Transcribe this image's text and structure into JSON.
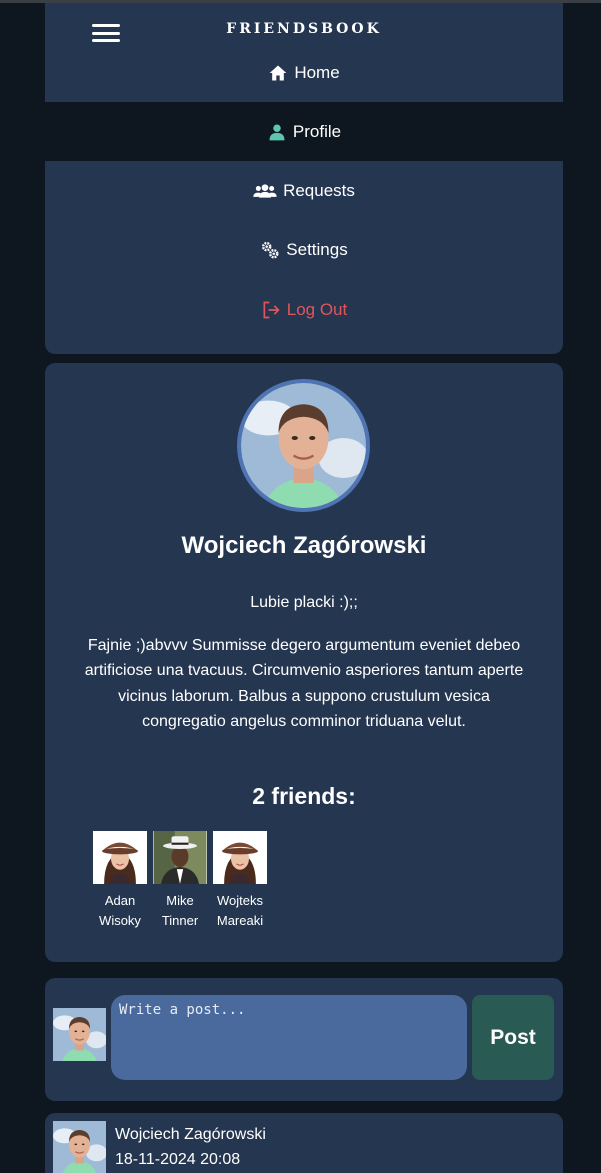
{
  "nav": {
    "brand": "FRIENDSBOOK",
    "items": [
      {
        "label": "Home",
        "icon": "home-icon"
      },
      {
        "label": "Profile",
        "icon": "user-icon"
      },
      {
        "label": "Requests",
        "icon": "users-icon"
      },
      {
        "label": "Settings",
        "icon": "gears-icon"
      },
      {
        "label": "Log Out",
        "icon": "logout-icon"
      }
    ]
  },
  "profile": {
    "name": "Wojciech Zagórowski",
    "status": "Lubie placki :);;",
    "bio": "Fajnie ;)abvvv Summisse degero argumentum eveniet debeo artificiose una tvacuus. Circumvenio asperiores tantum aperte vicinus laborum. Balbus a suppono crustulum vesica congregatio angelus comminor triduana velut.",
    "friends_title": "2 friends:",
    "friends": [
      {
        "first": "Adan",
        "last": "Wisoky"
      },
      {
        "first": "Mike",
        "last": "Tinner"
      },
      {
        "first": "Wojteks",
        "last": "Mareaki"
      }
    ]
  },
  "composer": {
    "placeholder": "Write a post...",
    "button_label": "Post"
  },
  "post": {
    "author": "Wojciech Zagórowski",
    "date": "18-11-2024 20:08"
  },
  "colors": {
    "background": "#0e1620",
    "card": "#253650",
    "accent": "#4f74b4",
    "logout": "#e0565b",
    "post_button": "#2a5a54"
  }
}
